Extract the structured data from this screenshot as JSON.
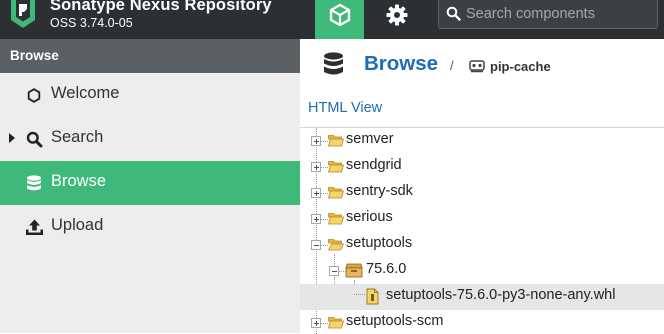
{
  "app": {
    "title": "Sonatype Nexus Repository",
    "version": "OSS 3.74.0-05"
  },
  "header": {
    "search_placeholder": "Search components"
  },
  "sidebar": {
    "title": "Browse",
    "items": [
      {
        "label": "Welcome",
        "icon": "hexagon-icon",
        "selected": false
      },
      {
        "label": "Search",
        "icon": "search-icon",
        "selected": false,
        "expandable": true
      },
      {
        "label": "Browse",
        "icon": "database-icon",
        "selected": true
      },
      {
        "label": "Upload",
        "icon": "upload-icon",
        "selected": false
      }
    ]
  },
  "main": {
    "title": "Browse",
    "breadcrumb_separator": "/",
    "repository": "pip-cache",
    "html_view_label": "HTML View",
    "tree": [
      {
        "label": "semver",
        "type": "folder",
        "expanded": false
      },
      {
        "label": "sendgrid",
        "type": "folder",
        "expanded": false
      },
      {
        "label": "sentry-sdk",
        "type": "folder",
        "expanded": false
      },
      {
        "label": "serious",
        "type": "folder",
        "expanded": false
      },
      {
        "label": "setuptools",
        "type": "folder",
        "expanded": true
      },
      {
        "label": "75.6.0",
        "type": "version",
        "expanded": true
      },
      {
        "label": "setuptools-75.6.0-py3-none-any.whl",
        "type": "file",
        "selected": true
      },
      {
        "label": "setuptools-scm",
        "type": "folder",
        "expanded": false
      }
    ]
  },
  "colors": {
    "header_bg": "#2c3033",
    "accent_green": "#3fb97a",
    "link_blue": "#1e6bb8",
    "sidebar_bg": "#ededed",
    "sidebar_header_bg": "#5a6064",
    "folder_yellow": "#f4c542"
  }
}
